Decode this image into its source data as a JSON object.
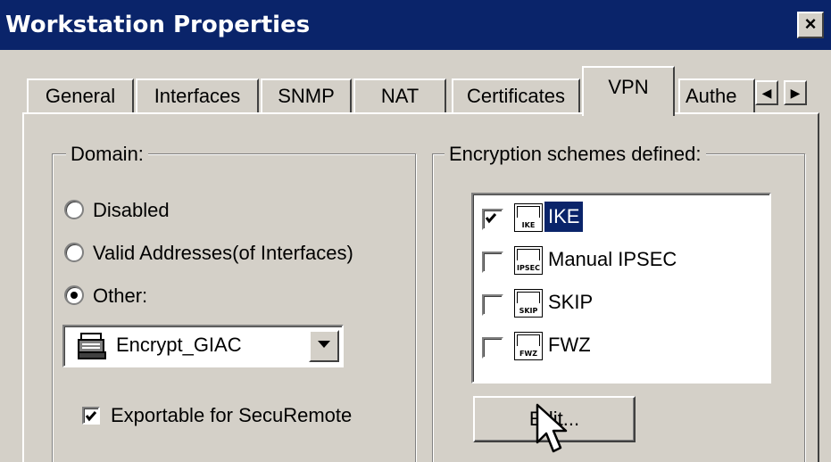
{
  "window": {
    "title": "Workstation Properties",
    "close_glyph": "×"
  },
  "tabs": [
    {
      "label": "General",
      "active": false
    },
    {
      "label": "Interfaces",
      "active": false
    },
    {
      "label": "SNMP",
      "active": false
    },
    {
      "label": "NAT",
      "active": false
    },
    {
      "label": "Certificates",
      "active": false
    },
    {
      "label": "VPN",
      "active": true
    },
    {
      "label": "Authe",
      "active": false
    }
  ],
  "tab_scroll": {
    "left_glyph": "◀",
    "right_glyph": "▶"
  },
  "domain": {
    "label": "Domain:",
    "options": [
      {
        "label": "Disabled",
        "selected": false
      },
      {
        "label": "Valid Addresses(of Interfaces)",
        "selected": false
      },
      {
        "label": "Other:",
        "selected": true
      }
    ],
    "combo_value": "Encrypt_GIAC",
    "combo_icon": "workstation-icon",
    "exportable": {
      "label": "Exportable for SecuRemote",
      "checked": true
    }
  },
  "encryption": {
    "label": "Encryption schemes defined:",
    "schemes": [
      {
        "label": "IKE",
        "icon_caption": "IKE",
        "checked": true,
        "selected": true
      },
      {
        "label": "Manual IPSEC",
        "icon_caption": "IPSEC",
        "checked": false,
        "selected": false
      },
      {
        "label": "SKIP",
        "icon_caption": "SKIP",
        "checked": false,
        "selected": false
      },
      {
        "label": "FWZ",
        "icon_caption": "FWZ",
        "checked": false,
        "selected": false
      }
    ],
    "edit_label": "Edit..."
  },
  "colors": {
    "face": "#d4d0c8",
    "titlebar": "#0a246a",
    "selection": "#0a246a"
  }
}
